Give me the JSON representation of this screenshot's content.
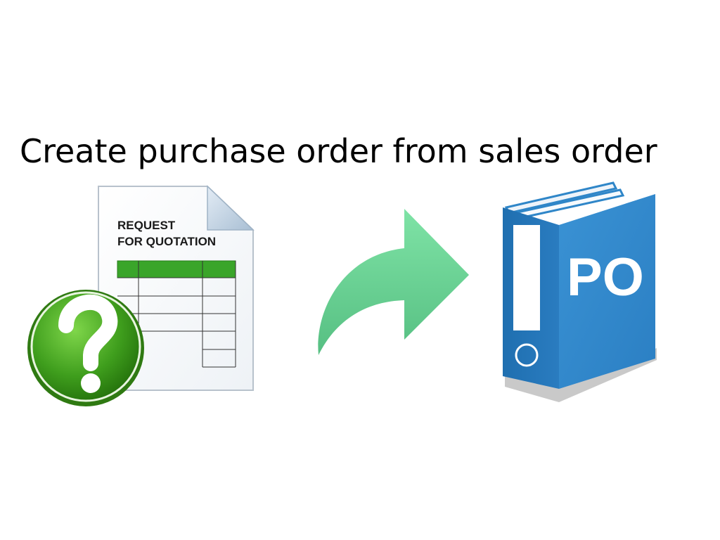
{
  "slide": {
    "headline": "Create purchase order from sales order"
  },
  "rfq_document": {
    "line1": "REQUEST",
    "line2": "FOR QUOTATION",
    "badge_icon": "question-mark-icon",
    "colors": {
      "table_header": "#3aa52a",
      "badge": "#3d9a1f"
    }
  },
  "arrow": {
    "icon": "curved-arrow-right-icon",
    "color": "#6fd59a"
  },
  "binder": {
    "label": "PO",
    "icon": "binder-icon",
    "color": "#2f86c8"
  }
}
